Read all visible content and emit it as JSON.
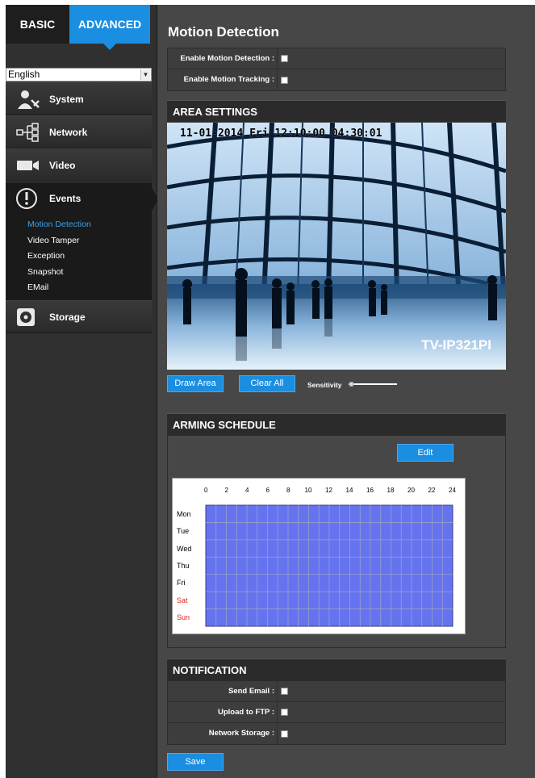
{
  "tabs": {
    "basic": "BASIC",
    "advanced": "ADVANCED"
  },
  "language": {
    "selected": "English"
  },
  "menu": [
    {
      "label": "System",
      "icon": "system-icon"
    },
    {
      "label": "Network",
      "icon": "network-icon"
    },
    {
      "label": "Video",
      "icon": "video-icon"
    },
    {
      "label": "Events",
      "icon": "events-icon"
    },
    {
      "label": "Storage",
      "icon": "storage-icon"
    }
  ],
  "events_submenu": [
    "Motion Detection",
    "Video Tamper",
    "Exception",
    "Snapshot",
    "EMail"
  ],
  "page": {
    "title": "Motion Detection",
    "enable_motion_detection": "Enable Motion Detection :",
    "enable_motion_tracking": "Enable Motion Tracking :"
  },
  "area": {
    "heading": "AREA SETTINGS",
    "osd": "11-01-2014 Fri 12:10:00 04:30:01",
    "model": "TV-IP321PI",
    "draw_area": "Draw Area",
    "clear_all": "Clear All",
    "sensitivity": "Sensitivity"
  },
  "schedule": {
    "heading": "ARMING SCHEDULE",
    "edit": "Edit",
    "hours": [
      "0",
      "2",
      "4",
      "6",
      "8",
      "10",
      "12",
      "14",
      "16",
      "18",
      "20",
      "22",
      "24"
    ],
    "days": [
      "Mon",
      "Tue",
      "Wed",
      "Thu",
      "Fri",
      "Sat",
      "Sun"
    ],
    "fill_color": "#6673ef",
    "weekend_color": "#e02020"
  },
  "notification": {
    "heading": "NOTIFICATION",
    "send_email": "Send Email :",
    "upload_ftp": "Upload to FTP :",
    "network_storage": "Network  Storage :"
  },
  "save": "Save",
  "colors": {
    "accent": "#1a8ee0",
    "active_submenu": "#3aa0ee"
  }
}
